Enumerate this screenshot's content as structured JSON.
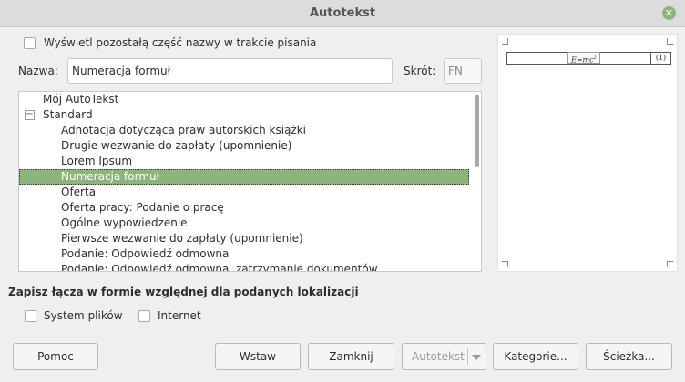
{
  "window": {
    "title": "Autotekst"
  },
  "options": {
    "show_remainder_label": "Wyświetl pozostałą część nazwy w trakcie pisania"
  },
  "name_field": {
    "label": "Nazwa:",
    "value": "Numeracja formuł"
  },
  "shortcut_field": {
    "label": "Skrót:",
    "value": "FN"
  },
  "tree": {
    "root": "Mój AutoTekst",
    "group": "Standard",
    "group_expander": "−",
    "items": [
      "Adnotacja dotycząca praw autorskich książki",
      "Drugie wezwanie do zapłaty (upomnienie)",
      "Lorem Ipsum",
      "Numeracja formuł",
      "Oferta",
      "Oferta pracy: Podanie o pracę",
      "Ogólne wypowiedzenie",
      "Pierwsze wezwanie do zapłaty (upomnienie)",
      "Podanie: Odpowiedź odmowna",
      "Podanie: Odpowiedź odmowna, zatrzymanie dokumentów"
    ],
    "selected_index": 3
  },
  "preview": {
    "formula": "E=mc",
    "formula_exponent": "2",
    "formula_number": "(1)"
  },
  "relative_links": {
    "title": "Zapisz łącza w formie względnej dla podanych lokalizacji",
    "file_system_label": "System plików",
    "internet_label": "Internet"
  },
  "buttons": {
    "help": "Pomoc",
    "insert": "Wstaw",
    "close": "Zamknij",
    "autotext": "Autotekst",
    "categories": "Kategorie...",
    "path": "Ścieżka..."
  },
  "colors": {
    "selection": "#8db47c",
    "close_button": "#8db47c"
  }
}
